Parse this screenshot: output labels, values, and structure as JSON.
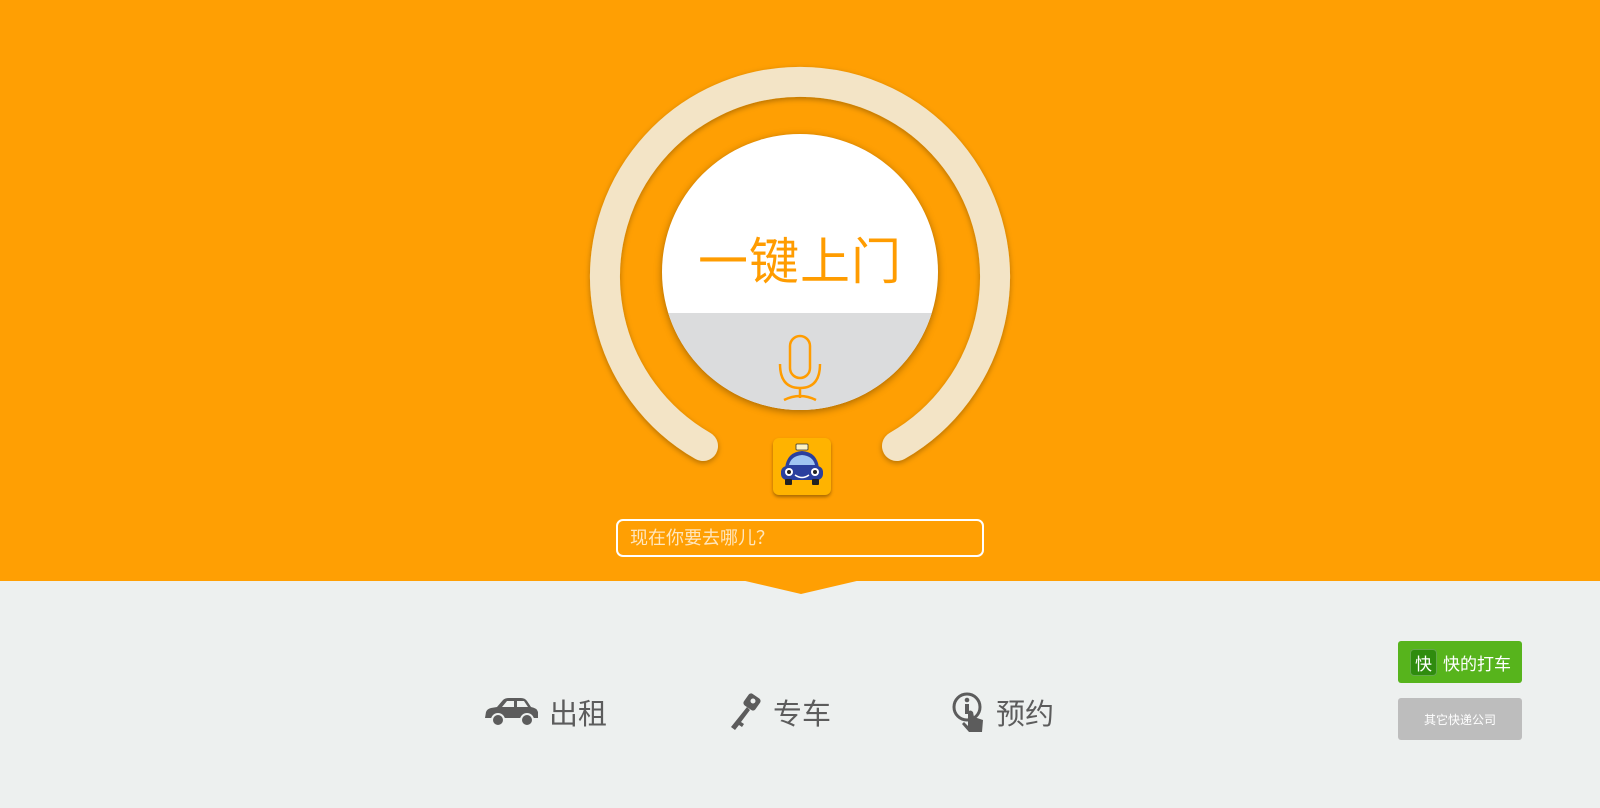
{
  "hero": {
    "title": "一键上门",
    "search_placeholder": "现在你要去哪儿？"
  },
  "nav": {
    "taxi_label": "出租",
    "private_car_label": "专车",
    "reservation_label": "预约"
  },
  "side": {
    "kuaidi_badge": "快",
    "kuaidi_label": "快的打车",
    "other_label": "其它快递公司"
  },
  "icons": [
    "microphone-icon",
    "taxi-icon",
    "car-icon",
    "key-icon",
    "touch-info-icon"
  ],
  "colors": {
    "brand_orange": "#ff9f03",
    "ring": "#f3e4c6",
    "green_button": "#57b41c",
    "gray_button": "#bdbdbd",
    "footer_bg": "#edf0ef"
  }
}
